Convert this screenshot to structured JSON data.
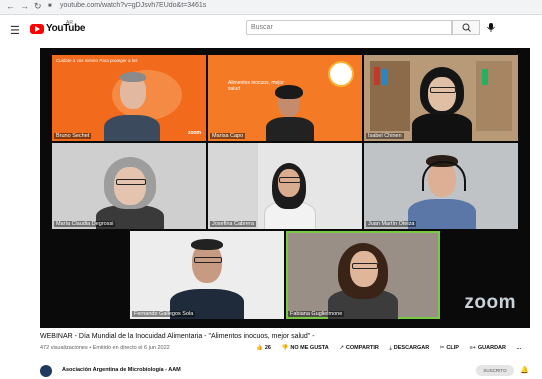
{
  "browser": {
    "url": "youtube.com/watch?v=gDJsvh7EUdo&t=3461s"
  },
  "header": {
    "logo_text": "YouTube",
    "region": "AR",
    "search_placeholder": "Buscar",
    "icons": [
      "menu-icon",
      "search-icon",
      "mic-icon"
    ]
  },
  "video": {
    "watermark": "zoom",
    "slide_top_left_text": "Cuidate a vos mismo Para proteger a los",
    "slide_top_mid_text": "Alimentos inocuos, mejor salud",
    "participants": [
      {
        "name": "Bruno Sechet",
        "extra": "zoom"
      },
      {
        "name": "Marisa Capo"
      },
      {
        "name": "Isabel Chinen"
      },
      {
        "name": "María Claudia Degrossi"
      },
      {
        "name": "Josefina Cabrera"
      },
      {
        "name": "Juan Martín Oteiza"
      },
      {
        "name": "Fernando Gallegos Sola"
      },
      {
        "name": "Fabiana Guglielmone"
      }
    ]
  },
  "info": {
    "title": "WEBINAR - Día Mundial de la Inocuidad Alimentaria - \"Alimentos inocuos, mejor salud\" -",
    "meta": "472 visualizaciones • Emitido en directo el 6 jun 2022",
    "actions": [
      {
        "icon": "like-icon",
        "label": "26"
      },
      {
        "icon": "dislike-icon",
        "label": "NO ME GUSTA"
      },
      {
        "icon": "share-icon",
        "label": "COMPARTIR"
      },
      {
        "icon": "download-icon",
        "label": "DESCARGAR"
      },
      {
        "icon": "clip-icon",
        "label": "CLIP"
      },
      {
        "icon": "save-icon",
        "label": "GUARDAR"
      },
      {
        "icon": "more-icon",
        "label": "..."
      }
    ]
  },
  "channel": {
    "name": "Asociación Argentina de Microbiología - AAM",
    "subscribe": "SUSCRITO"
  },
  "colors": {
    "youtube_red": "#ff0000",
    "slide_orange": "#f26a1b",
    "active_speaker": "#7ac943"
  }
}
